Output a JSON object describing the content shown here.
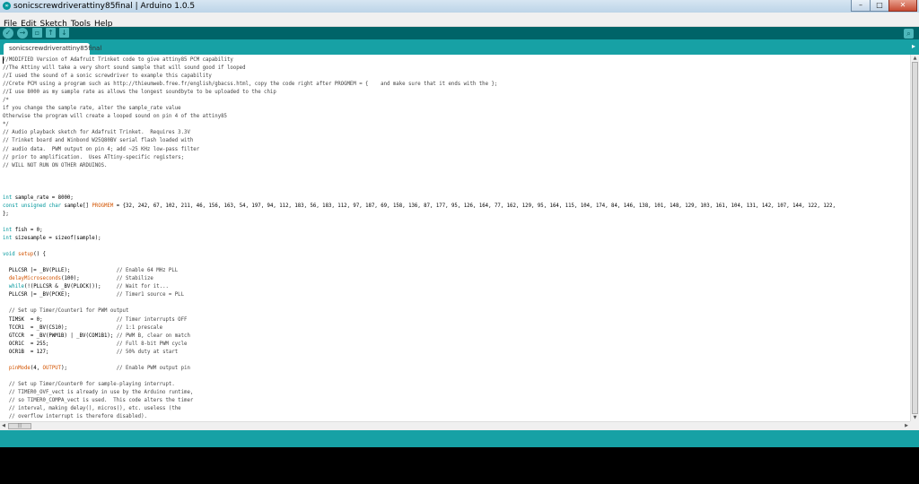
{
  "window": {
    "title": "sonicscrewdriverattiny85final | Arduino 1.0.5",
    "app_icon": "arduino-logo-icon",
    "controls": {
      "minimize": "–",
      "maximize": "□",
      "close": "✕"
    }
  },
  "menu": [
    "File",
    "Edit",
    "Sketch",
    "Tools",
    "Help"
  ],
  "toolbar": {
    "icons": [
      "verify-icon",
      "upload-icon",
      "new-icon",
      "open-icon",
      "save-icon",
      "serial-monitor-icon"
    ]
  },
  "tabs": [
    {
      "label": "sonicscrewdriverattiny85final",
      "active": true
    }
  ],
  "colors": {
    "toolbar": "#006468",
    "tab_strip": "#17a1a5",
    "keyword": "#00979c",
    "function": "#d35400"
  },
  "code_lines": [
    "//MODIFIED Version of Adafruit Trinket code to give attiny85 PCM capability",
    "//The Attiny will take a very short sound sample that will sound good if looped",
    "//I used the sound of a sonic screwdriver to example this capability",
    "//Crete PCM using a program such as http://thieumweb.free.fr/english/gbacss.html, copy the code right after PROGMEM = {    and make sure that it ends with the };",
    "//I use 8000 as my sample rate as allows the longest soundbyte to be uploaded to the chip",
    "/*",
    "if you change the sample rate, alter the sample_rate value",
    "Otherwise the program will create a looped sound on pin 4 of the attiny85",
    "*/",
    "// Audio playback sketch for Adafruit Trinket.  Requires 3.3V",
    "// Trinket board and Winbond W25Q80BV serial flash loaded with",
    "// audio data.  PWM output on pin 4; add ~25 KHz low-pass filter",
    "// prior to amplification.  Uses ATtiny-specific registers;",
    "// WILL NOT RUN ON OTHER ARDUINOS.",
    "",
    "",
    "",
    "int sample_rate = 8000;",
    "const unsigned char sample[] PROGMEM = {32, 242, 67, 102, 211, 46, 156, 163, 54, 197, 94, 112, 183, 56, 183, 112, 97, 187, 69, 158, 136, 87, 177, 95, 126, 164, 77, 162, 129, 95, 164, 115, 104, 174, 84, 146, 138, 101, 148, 129, 103, 161, 104, 131, 142, 107, 144, 122, 122,",
    "};",
    "",
    "int fish = 0;",
    "int sizesample = sizeof(sample);",
    "",
    "void setup() {",
    "",
    "  PLLCSR |= _BV(PLLE);               // Enable 64 MHz PLL",
    "  delayMicroseconds(100);            // Stabilize",
    "  while(!(PLLCSR & _BV(PLOCK)));     // Wait for it...",
    "  PLLCSR |= _BV(PCKE);               // Timer1 source = PLL",
    "",
    "  // Set up Timer/Counter1 for PWM output",
    "  TIMSK  = 0;                        // Timer interrupts OFF",
    "  TCCR1  = _BV(CS10);                // 1:1 prescale",
    "  GTCCR  = _BV(PWM1B) | _BV(COM1B1); // PWM B, clear on match",
    "  OCR1C  = 255;                      // Full 8-bit PWM cycle",
    "  OCR1B  = 127;                      // 50% duty at start",
    "",
    "  pinMode(4, OUTPUT);                // Enable PWM output pin",
    "",
    "  // Set up Timer/Counter0 for sample-playing interrupt.",
    "  // TIMER0_OVF_vect is already in use by the Arduino runtime,",
    "  // so TIMER0_COMPA_vect is used.  This code alters the timer",
    "  // interval, making delay(), micros(), etc. useless (the",
    "  // overflow interrupt is therefore disabled)."
  ]
}
